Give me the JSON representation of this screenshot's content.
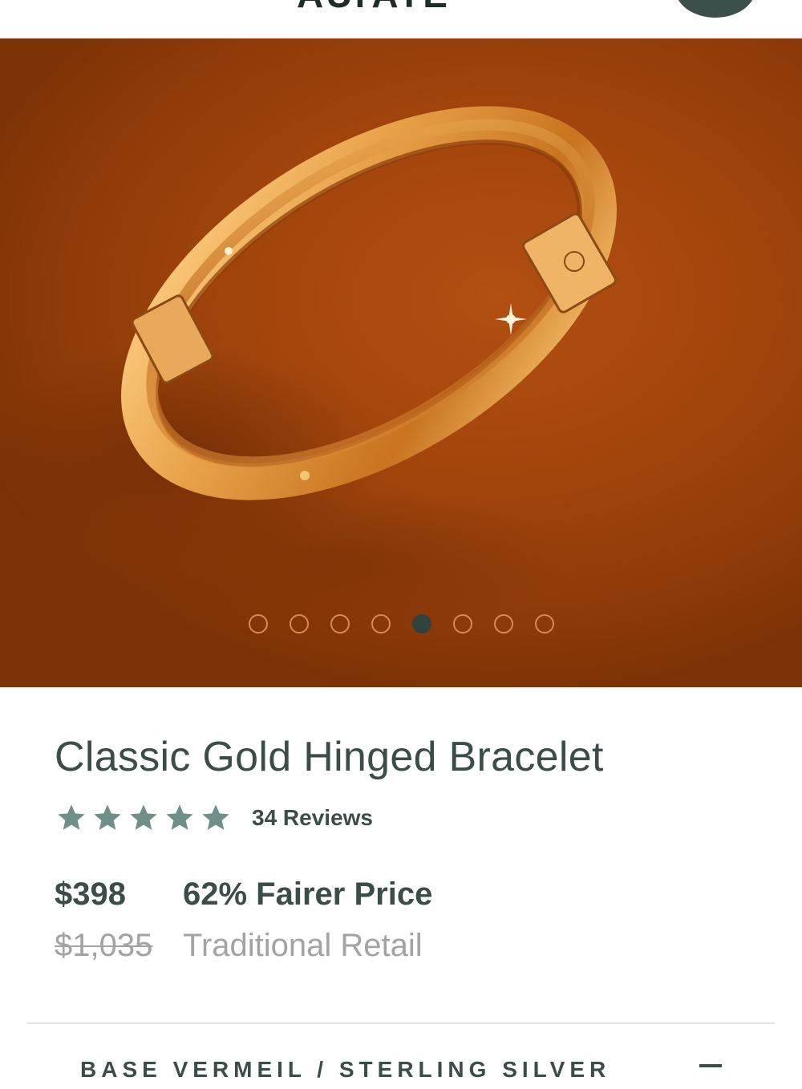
{
  "header": {
    "logo_text": "AUrATE"
  },
  "hero": {
    "image_alt": "Gold hinged bangle bracelet on orange backdrop",
    "carousel": {
      "total": 8,
      "active": 5
    }
  },
  "product": {
    "title": "Classic Gold Hinged Bracelet",
    "rating": {
      "stars": 5,
      "reviews_label": "34 Reviews"
    },
    "price": "$398",
    "fairer_label": "62% Fairer Price",
    "retail_price": "$1,035",
    "retail_label": "Traditional Retail"
  },
  "options": {
    "label": "BASE    VERMEIL / STERLING SILVER"
  },
  "colors": {
    "accent": "#3a4d49",
    "star": "#6f9089",
    "muted": "#a3a3a3",
    "active_dot": "#2f423e"
  }
}
